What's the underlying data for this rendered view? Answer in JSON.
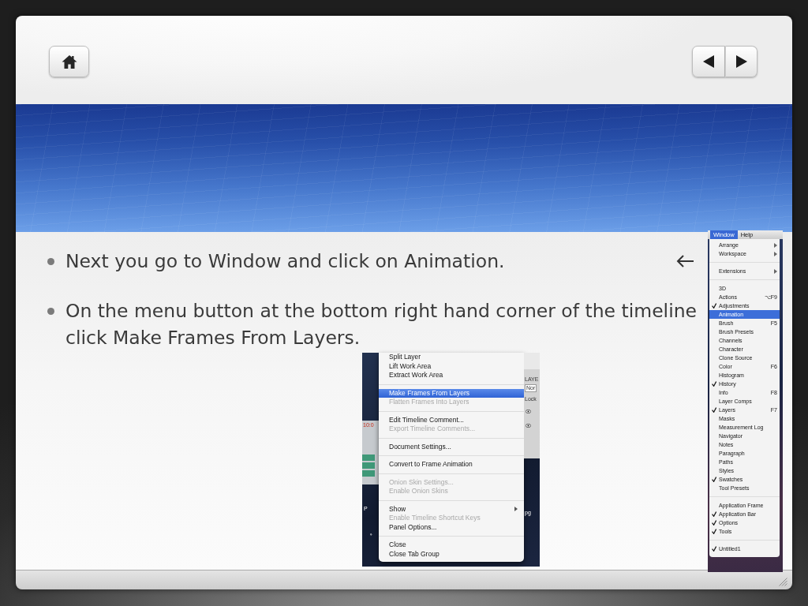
{
  "slide": {
    "bullets": [
      {
        "text": "Next you go to Window and click on Animation.",
        "arrow": true
      },
      {
        "text": "On the menu button at the bottom right hand corner of the timeline click Make Frames From Layers.",
        "arrow": false
      }
    ]
  },
  "timeline_menu_screenshot": {
    "left_strip": {
      "timecode": "10:0",
      "caption": "P"
    },
    "right_strip": {
      "panel_title": "LAYE",
      "dropdown": "Nor",
      "lock_label": "Lock",
      "caption": "pg"
    },
    "menu": [
      {
        "kind": "item",
        "label": "Split Layer",
        "selected": false,
        "disabled": false,
        "submenu": false
      },
      {
        "kind": "item",
        "label": "Lift Work Area",
        "selected": false,
        "disabled": false,
        "submenu": false
      },
      {
        "kind": "item",
        "label": "Extract Work Area",
        "selected": false,
        "disabled": false,
        "submenu": false
      },
      {
        "kind": "separator"
      },
      {
        "kind": "item",
        "label": "Make Frames From Layers",
        "selected": true,
        "disabled": false,
        "submenu": false
      },
      {
        "kind": "item",
        "label": "Flatten Frames Into Layers",
        "selected": false,
        "disabled": true,
        "submenu": false
      },
      {
        "kind": "separator"
      },
      {
        "kind": "item",
        "label": "Edit Timeline Comment...",
        "selected": false,
        "disabled": false,
        "submenu": false
      },
      {
        "kind": "item",
        "label": "Export Timeline Comments...",
        "selected": false,
        "disabled": true,
        "submenu": false
      },
      {
        "kind": "separator"
      },
      {
        "kind": "item",
        "label": "Document Settings...",
        "selected": false,
        "disabled": false,
        "submenu": false
      },
      {
        "kind": "separator"
      },
      {
        "kind": "item",
        "label": "Convert to Frame Animation",
        "selected": false,
        "disabled": false,
        "submenu": false
      },
      {
        "kind": "separator"
      },
      {
        "kind": "item",
        "label": "Onion Skin Settings...",
        "selected": false,
        "disabled": true,
        "submenu": false
      },
      {
        "kind": "item",
        "label": "Enable Onion Skins",
        "selected": false,
        "disabled": true,
        "submenu": false
      },
      {
        "kind": "separator"
      },
      {
        "kind": "item",
        "label": "Show",
        "selected": false,
        "disabled": false,
        "submenu": true
      },
      {
        "kind": "item",
        "label": "Enable Timeline Shortcut Keys",
        "selected": false,
        "disabled": true,
        "submenu": false
      },
      {
        "kind": "item",
        "label": "Panel Options...",
        "selected": false,
        "disabled": false,
        "submenu": false
      },
      {
        "kind": "separator"
      },
      {
        "kind": "item",
        "label": "Close",
        "selected": false,
        "disabled": false,
        "submenu": false
      },
      {
        "kind": "item",
        "label": "Close Tab Group",
        "selected": false,
        "disabled": false,
        "submenu": false
      }
    ]
  },
  "window_menu_screenshot": {
    "menubar": [
      {
        "label": "Window",
        "selected": true
      },
      {
        "label": "Help",
        "selected": false
      }
    ],
    "menu": [
      {
        "kind": "item",
        "label": "Arrange",
        "checked": false,
        "selected": false,
        "submenu": true
      },
      {
        "kind": "item",
        "label": "Workspace",
        "checked": false,
        "selected": false,
        "submenu": true
      },
      {
        "kind": "separator"
      },
      {
        "kind": "item",
        "label": "Extensions",
        "checked": false,
        "selected": false,
        "submenu": true
      },
      {
        "kind": "separator"
      },
      {
        "kind": "item",
        "label": "3D",
        "checked": false,
        "selected": false,
        "submenu": false
      },
      {
        "kind": "item",
        "label": "Actions",
        "checked": false,
        "selected": false,
        "submenu": false,
        "shortcut": "⌥F9"
      },
      {
        "kind": "item",
        "label": "Adjustments",
        "checked": true,
        "selected": false,
        "submenu": false
      },
      {
        "kind": "item",
        "label": "Animation",
        "checked": false,
        "selected": true,
        "submenu": false
      },
      {
        "kind": "item",
        "label": "Brush",
        "checked": false,
        "selected": false,
        "submenu": false,
        "shortcut": "F5"
      },
      {
        "kind": "item",
        "label": "Brush Presets",
        "checked": false,
        "selected": false,
        "submenu": false
      },
      {
        "kind": "item",
        "label": "Channels",
        "checked": false,
        "selected": false,
        "submenu": false
      },
      {
        "kind": "item",
        "label": "Character",
        "checked": false,
        "selected": false,
        "submenu": false
      },
      {
        "kind": "item",
        "label": "Clone Source",
        "checked": false,
        "selected": false,
        "submenu": false
      },
      {
        "kind": "item",
        "label": "Color",
        "checked": false,
        "selected": false,
        "submenu": false,
        "shortcut": "F6"
      },
      {
        "kind": "item",
        "label": "Histogram",
        "checked": false,
        "selected": false,
        "submenu": false
      },
      {
        "kind": "item",
        "label": "History",
        "checked": true,
        "selected": false,
        "submenu": false
      },
      {
        "kind": "item",
        "label": "Info",
        "checked": false,
        "selected": false,
        "submenu": false,
        "shortcut": "F8"
      },
      {
        "kind": "item",
        "label": "Layer Comps",
        "checked": false,
        "selected": false,
        "submenu": false
      },
      {
        "kind": "item",
        "label": "Layers",
        "checked": true,
        "selected": false,
        "submenu": false,
        "shortcut": "F7"
      },
      {
        "kind": "item",
        "label": "Masks",
        "checked": false,
        "selected": false,
        "submenu": false
      },
      {
        "kind": "item",
        "label": "Measurement Log",
        "checked": false,
        "selected": false,
        "submenu": false
      },
      {
        "kind": "item",
        "label": "Navigator",
        "checked": false,
        "selected": false,
        "submenu": false
      },
      {
        "kind": "item",
        "label": "Notes",
        "checked": false,
        "selected": false,
        "submenu": false
      },
      {
        "kind": "item",
        "label": "Paragraph",
        "checked": false,
        "selected": false,
        "submenu": false
      },
      {
        "kind": "item",
        "label": "Paths",
        "checked": false,
        "selected": false,
        "submenu": false
      },
      {
        "kind": "item",
        "label": "Styles",
        "checked": false,
        "selected": false,
        "submenu": false
      },
      {
        "kind": "item",
        "label": "Swatches",
        "checked": true,
        "selected": false,
        "submenu": false
      },
      {
        "kind": "item",
        "label": "Tool Presets",
        "checked": false,
        "selected": false,
        "submenu": false
      },
      {
        "kind": "separator"
      },
      {
        "kind": "item",
        "label": "Application Frame",
        "checked": false,
        "selected": false,
        "submenu": false
      },
      {
        "kind": "item",
        "label": "Application Bar",
        "checked": true,
        "selected": false,
        "submenu": false
      },
      {
        "kind": "item",
        "label": "Options",
        "checked": true,
        "selected": false,
        "submenu": false
      },
      {
        "kind": "item",
        "label": "Tools",
        "checked": true,
        "selected": false,
        "submenu": false
      },
      {
        "kind": "separator"
      },
      {
        "kind": "item",
        "label": "Untitled1",
        "checked": true,
        "selected": false,
        "submenu": false
      }
    ]
  }
}
